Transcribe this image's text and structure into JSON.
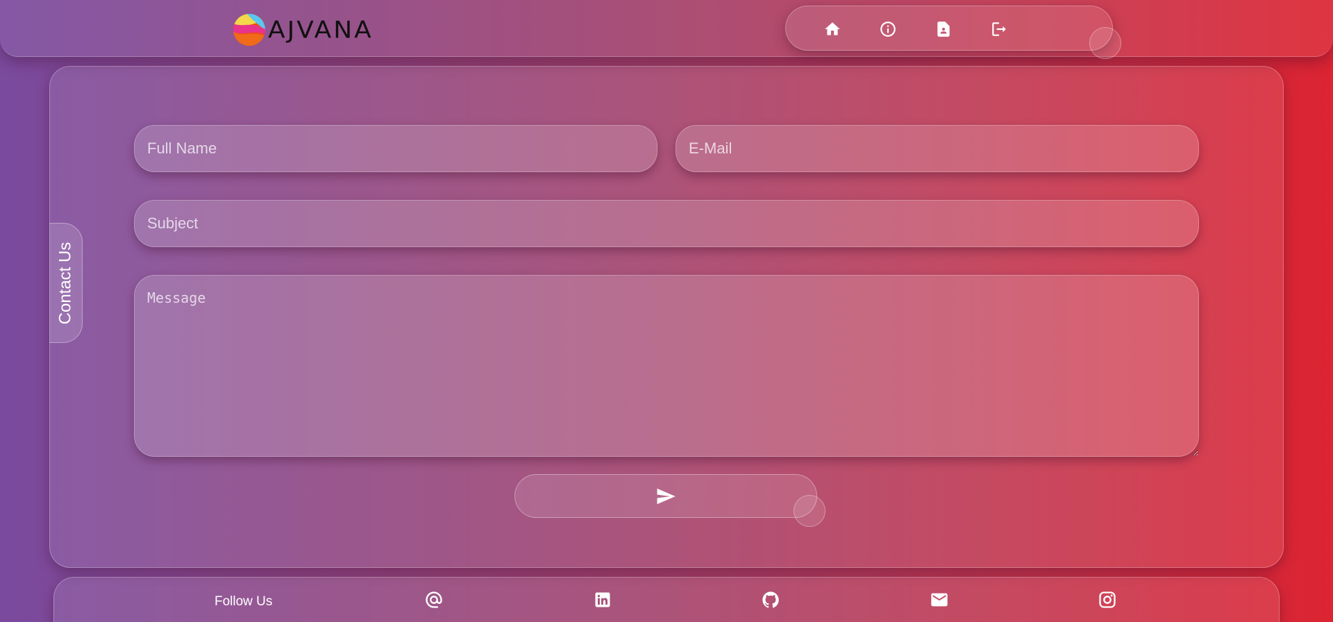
{
  "header": {
    "logo_text": "AJVANA",
    "nav": [
      {
        "icon": "home-icon"
      },
      {
        "icon": "info-icon"
      },
      {
        "icon": "contact-card-icon"
      },
      {
        "icon": "logout-icon"
      }
    ]
  },
  "contact": {
    "tab_label": "Contact Us",
    "full_name_placeholder": "Full Name",
    "email_placeholder": "E-Mail",
    "subject_placeholder": "Subject",
    "message_placeholder": "Message",
    "send_icon": "send-icon"
  },
  "footer": {
    "follow_label": "Follow Us",
    "socials": [
      "at-sign-icon",
      "linkedin-icon",
      "github-icon",
      "mail-icon",
      "instagram-icon"
    ]
  },
  "colors": {
    "gradient_start": "#7a4a9e",
    "gradient_end": "#dc2432"
  }
}
